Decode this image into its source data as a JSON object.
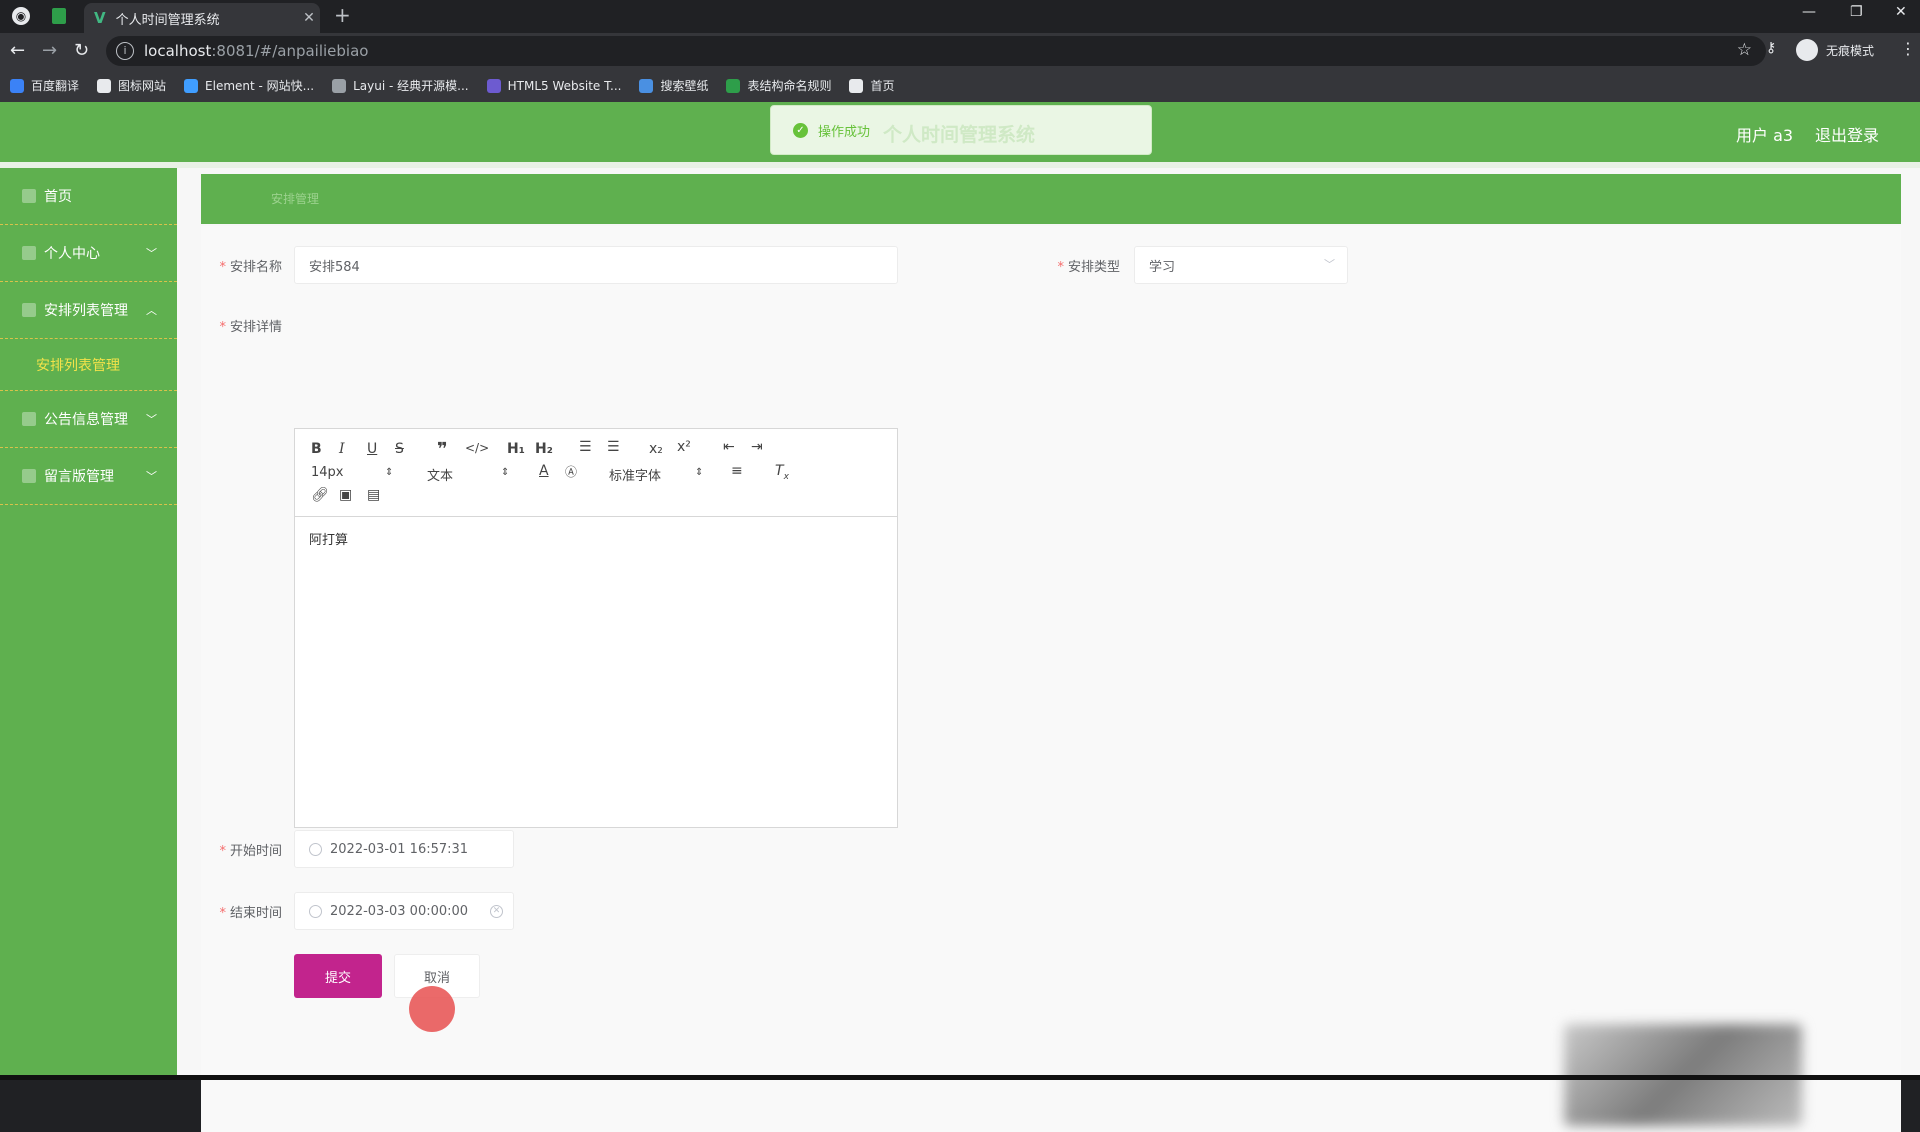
{
  "browser": {
    "tab_title": "个人时间管理系统",
    "url_host": "localhost",
    "url_path": ":8081/#/anpailiebiao",
    "incognito_label": "无痕模式",
    "bookmarks": [
      {
        "label": "百度翻译",
        "color": "#3b82f6"
      },
      {
        "label": "图标网站",
        "color": "#e8eaed"
      },
      {
        "label": "Element - 网站快...",
        "color": "#409eff"
      },
      {
        "label": "Layui - 经典开源模...",
        "color": "#9aa0a6"
      },
      {
        "label": "HTML5 Website T...",
        "color": "#6d5bd0"
      },
      {
        "label": "搜索壁纸",
        "color": "#4a90e2"
      },
      {
        "label": "表结构命名规则",
        "color": "#2e9e4a"
      },
      {
        "label": "首页",
        "color": "#e8eaed"
      }
    ]
  },
  "header": {
    "toast_message": "操作成功",
    "app_title_ghost": "个人时间管理系统",
    "user_label": "用户 a3",
    "logout_label": "退出登录",
    "accent_color": "#5fb04f"
  },
  "sidebar": {
    "items": [
      {
        "label": "首页",
        "chevron": ""
      },
      {
        "label": "个人中心",
        "chevron": "﹀"
      },
      {
        "label": "安排列表管理",
        "chevron": "︿"
      },
      {
        "label": "公告信息管理",
        "chevron": "﹀"
      },
      {
        "label": "留言版管理",
        "chevron": "﹀"
      }
    ],
    "active_sub_item": "安排列表管理"
  },
  "breadcrumb": "安排管理",
  "form": {
    "name_label": "安排名称",
    "name_value": "安排584",
    "type_label": "安排类型",
    "type_value": "学习",
    "detail_label": "安排详情",
    "editor": {
      "font_size": "14px",
      "text_style": "文本",
      "font_family": "标准字体",
      "content": "阿打算"
    },
    "start_label": "开始时间",
    "start_value": "2022-03-01 16:57:31",
    "end_label": "结束时间",
    "end_value": "2022-03-03 00:00:00",
    "submit_label": "提交",
    "cancel_label": "取消"
  }
}
